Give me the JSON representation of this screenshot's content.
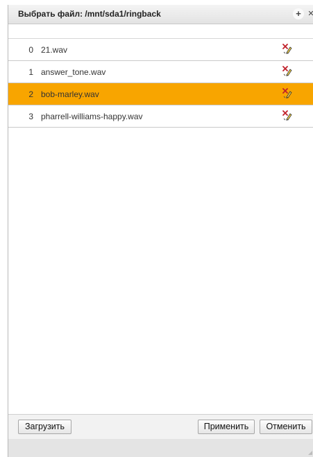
{
  "dialog": {
    "title": "Выбрать файл: /mnt/sda1/ringback",
    "icons": {
      "add": "plus-icon",
      "close": "close-icon"
    }
  },
  "files": [
    {
      "index": "0",
      "name": "21.wav",
      "selected": false
    },
    {
      "index": "1",
      "name": "answer_tone.wav",
      "selected": false
    },
    {
      "index": "2",
      "name": "bob-marley.wav",
      "selected": true
    },
    {
      "index": "3",
      "name": "pharrell-williams-happy.wav",
      "selected": false
    }
  ],
  "row_action_icon": "delete-edit-icon",
  "footer": {
    "upload_label": "Загрузить",
    "apply_label": "Применить",
    "cancel_label": "Отменить"
  },
  "colors": {
    "selected_row": "#f8a500",
    "titlebar": "#e9e9e9",
    "footer": "#f2f2f2"
  }
}
